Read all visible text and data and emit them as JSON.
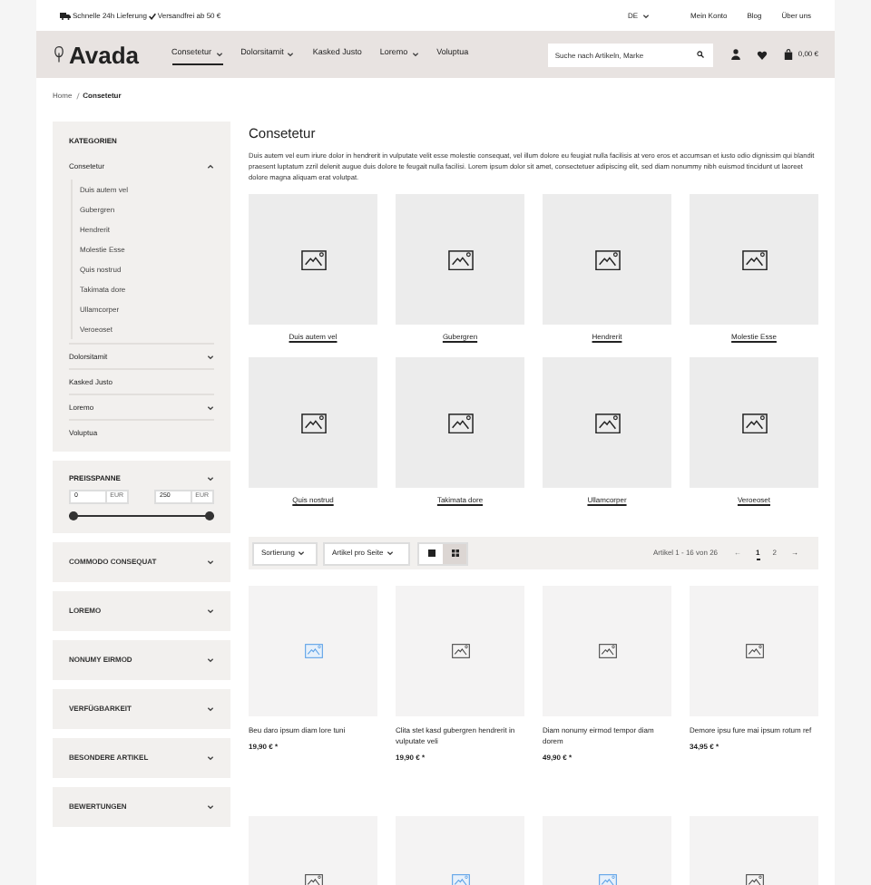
{
  "top_bar": {
    "shipping": "Schnelle 24h Lieferung",
    "free_shipping": "Versandfrei ab 50 €",
    "language": "DE",
    "links": [
      "Mein Konto",
      "Blog",
      "Über uns"
    ]
  },
  "header": {
    "logo": "Avada",
    "nav": [
      {
        "label": "Consetetur",
        "selected": true,
        "dropdown": true
      },
      {
        "label": "Dolorsitamit",
        "selected": false,
        "dropdown": true
      },
      {
        "label": "Kasked Justo",
        "selected": false,
        "dropdown": false
      },
      {
        "label": "Loremo",
        "selected": false,
        "dropdown": true
      },
      {
        "label": "Voluptua",
        "selected": false,
        "dropdown": false
      }
    ],
    "search": {
      "placeholder": "Suche nach Artikeln, Marke"
    },
    "cart_total": "0,00 €"
  },
  "breadcrumb": [
    "Home",
    "Consetetur"
  ],
  "sidebar": {
    "categories_title": "KATEGORIEN",
    "categories": [
      {
        "label": "Consetetur",
        "expanded": true,
        "children": [
          {
            "label": "Duis autem vel"
          },
          {
            "label": "Gubergren"
          },
          {
            "label": "Hendrerit"
          },
          {
            "label": "Molestie Esse"
          },
          {
            "label": "Quis nostrud"
          },
          {
            "label": "Takimata dore"
          },
          {
            "label": "Ullamcorper"
          },
          {
            "label": "Veroeoset"
          }
        ]
      },
      {
        "label": "Dolorsitamit",
        "expanded": false
      },
      {
        "label": "Kasked Justo"
      },
      {
        "label": "Loremo",
        "expanded": false
      },
      {
        "label": "Voluptua"
      }
    ],
    "price": {
      "title": "PREISSPANNE",
      "min": "0",
      "max": "250",
      "unit_min": "EUR",
      "unit_max": "EUR",
      "level": 1
    },
    "filters": [
      {
        "title": "COMMODO CONSEQUAT",
        "expanded": false
      },
      {
        "title": "LOREMO",
        "expanded": false
      },
      {
        "title": "NONUMY EIRMOD",
        "expanded": false
      },
      {
        "title": "VERFÜGBARKEIT",
        "expanded": false
      },
      {
        "title": "BESONDERE ARTIKEL",
        "expanded": false
      },
      {
        "title": "BEWERTUNGEN",
        "expanded": false
      }
    ]
  },
  "main": {
    "title": "Consetetur",
    "description": "Duis autem vel eum iriure dolor in hendrerit in vulputate velit esse molestie consequat, vel illum dolore eu feugiat nulla facilisis at vero eros et accumsan et iusto odio dignissim qui blandit praesent luptatum zzril delenit augue duis dolore te feugait nulla facilisi. Lorem ipsum dolor sit amet, consectetuer adipiscing elit, sed diam nonummy nibh euismod tincidunt ut laoreet dolore magna aliquam erat volutpat.",
    "subcategories": [
      {
        "label": "Duis autem vel"
      },
      {
        "label": "Gubergren"
      },
      {
        "label": "Hendrerit"
      },
      {
        "label": "Molestie Esse"
      },
      {
        "label": "Quis nostrud"
      },
      {
        "label": "Takimata dore"
      },
      {
        "label": "Ullamcorper"
      },
      {
        "label": "Veroeoset"
      }
    ],
    "toolbar": {
      "sort": "Sortierung",
      "per_page": "Artikel pro Seite",
      "views": [
        {
          "kind": "list",
          "selected": false
        },
        {
          "kind": "grid",
          "selected": true
        }
      ],
      "count": "Artikel 1 - 16 von 26",
      "prev": "←",
      "pages": [
        {
          "label": "1",
          "selected": true
        },
        {
          "label": "2",
          "selected": false
        }
      ],
      "next": "→"
    },
    "products": [
      {
        "name": "Beu daro ipsum diam lore tuni",
        "price": "19,90 € *",
        "highlighted": true
      },
      {
        "name": "Clita stet kasd gubergren hendrerit in vulputate veli",
        "price": "19,90 € *",
        "highlighted": false
      },
      {
        "name": "Diam nonumy eirmod tempor diam dorem",
        "price": "49,90 € *",
        "highlighted": false
      },
      {
        "name": "Demore ipsu fure mai ipsum rotum ref",
        "price": "34,95 € *",
        "highlighted": false
      },
      {
        "highlighted": false
      },
      {
        "highlighted": true
      },
      {
        "highlighted": true
      },
      {
        "highlighted": false
      }
    ]
  }
}
